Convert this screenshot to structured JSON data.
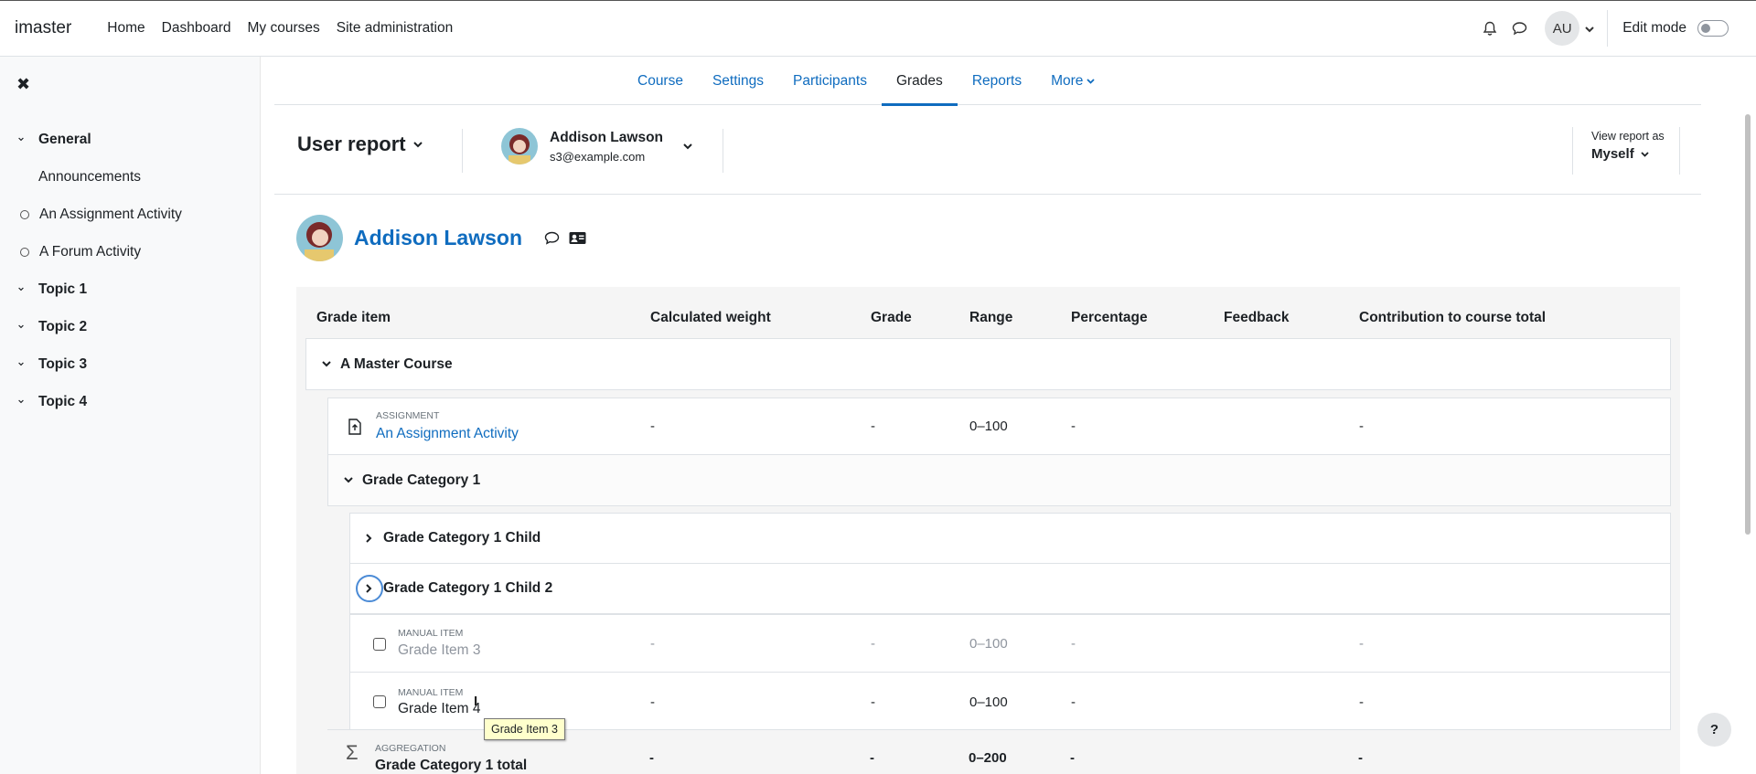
{
  "navbar": {
    "brand": "imaster",
    "links": [
      "Home",
      "Dashboard",
      "My courses",
      "Site administration"
    ],
    "user_initials": "AU",
    "edit_mode_label": "Edit mode"
  },
  "drawer": {
    "items": [
      {
        "label": "General",
        "type": "section"
      },
      {
        "label": "Announcements",
        "type": "child"
      },
      {
        "label": "An Assignment Activity",
        "type": "activity"
      },
      {
        "label": "A Forum Activity",
        "type": "activity"
      },
      {
        "label": "Topic 1",
        "type": "section"
      },
      {
        "label": "Topic 2",
        "type": "section"
      },
      {
        "label": "Topic 3",
        "type": "section"
      },
      {
        "label": "Topic 4",
        "type": "section"
      }
    ]
  },
  "secondary_nav": {
    "tabs": [
      "Course",
      "Settings",
      "Participants",
      "Grades",
      "Reports",
      "More"
    ],
    "active": "Grades"
  },
  "report": {
    "title": "User report",
    "user_name": "Addison Lawson",
    "user_email": "s3@example.com",
    "view_as_label": "View report as",
    "view_as_value": "Myself"
  },
  "user_heading": {
    "name": "Addison Lawson"
  },
  "table": {
    "headers": [
      "Grade item",
      "Calculated weight",
      "Grade",
      "Range",
      "Percentage",
      "Feedback",
      "Contribution to course total"
    ],
    "course_category": "A Master Course",
    "assignment": {
      "type": "ASSIGNMENT",
      "name": "An Assignment Activity",
      "weight": "-",
      "grade": "-",
      "range": "0–100",
      "percentage": "-",
      "contribution": "-"
    },
    "category1": "Grade Category 1",
    "child1": "Grade Category 1 Child",
    "child2": "Grade Category 1 Child 2",
    "item3": {
      "type": "MANUAL ITEM",
      "name": "Grade Item 3",
      "weight": "-",
      "grade": "-",
      "range": "0–100",
      "percentage": "-",
      "contribution": "-"
    },
    "item4": {
      "type": "MANUAL ITEM",
      "name": "Grade Item 4",
      "weight": "-",
      "grade": "-",
      "range": "0–100",
      "percentage": "-",
      "contribution": "-"
    },
    "total": {
      "type": "AGGREGATION",
      "name": "Grade Category 1 total",
      "weight": "-",
      "grade": "-",
      "range": "0–200",
      "percentage": "-",
      "contribution": "-"
    }
  },
  "tooltip": "Grade Item 3",
  "help": "?"
}
